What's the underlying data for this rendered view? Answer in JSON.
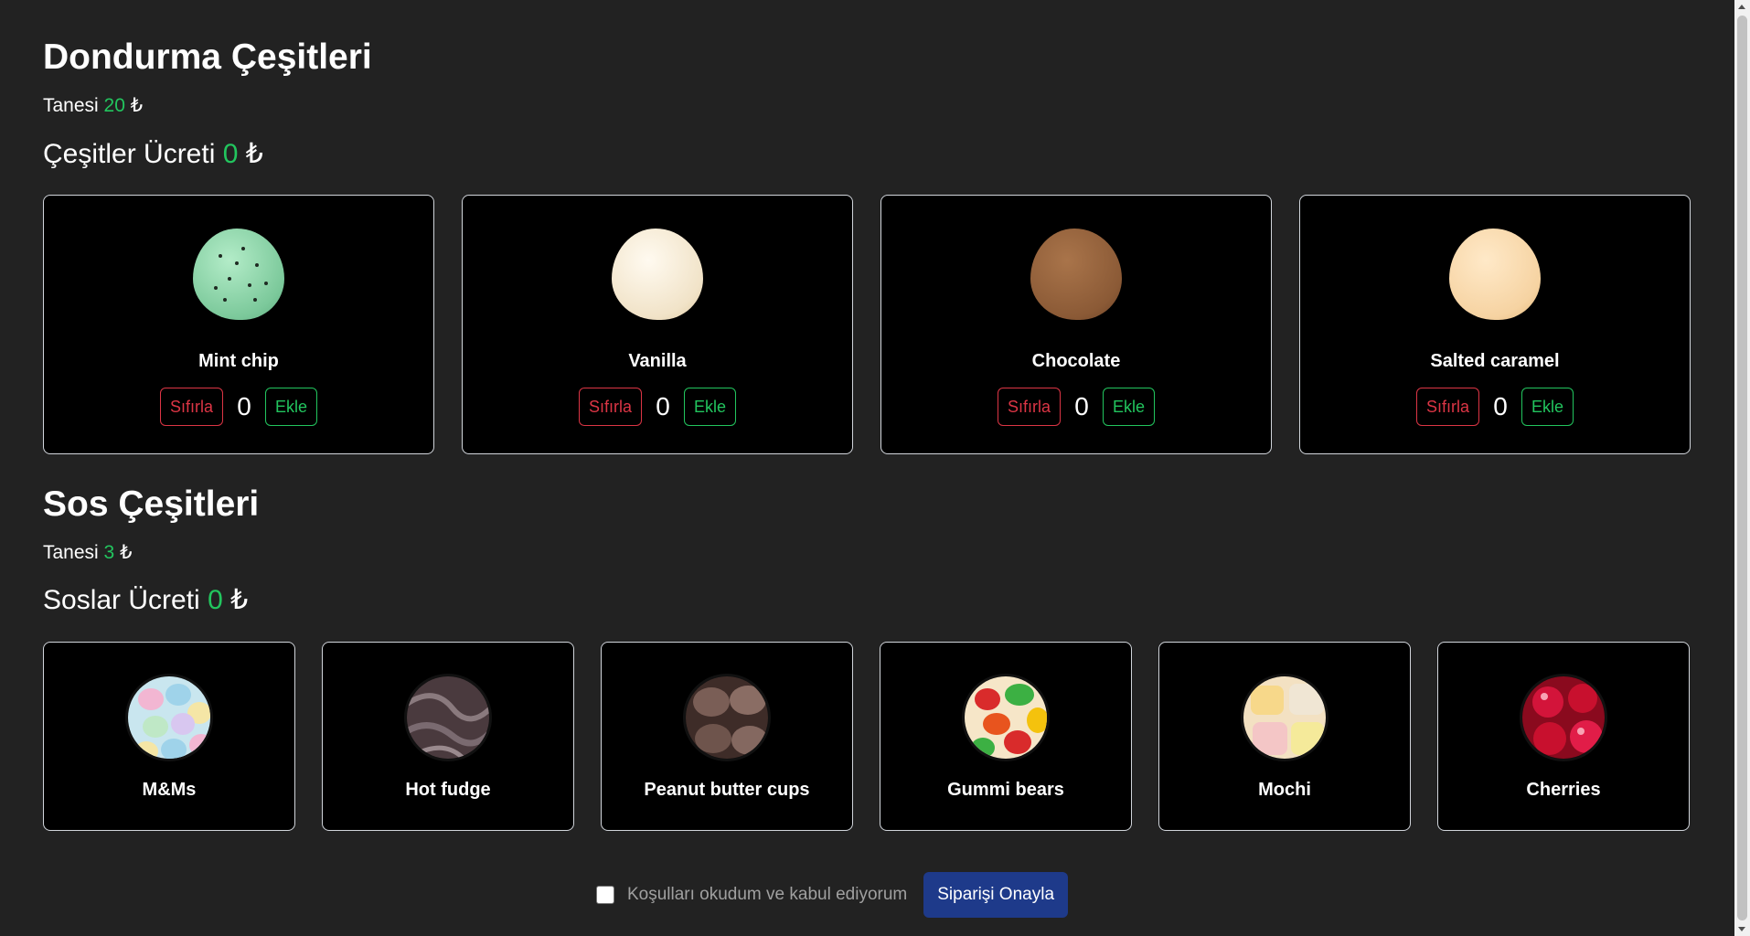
{
  "flavors_section": {
    "title": "Dondurma Çeşitleri",
    "unit_price_label": "Tanesi",
    "unit_price": "20",
    "currency": "₺",
    "fee_label": "Çeşitler Ücreti",
    "fee": "0",
    "items": [
      {
        "name": "Mint chip",
        "count": "0",
        "reset_label": "Sıfırla",
        "add_label": "Ekle",
        "icon": "mint-chip-scoop-icon",
        "color": "#8fd6ad"
      },
      {
        "name": "Vanilla",
        "count": "0",
        "reset_label": "Sıfırla",
        "add_label": "Ekle",
        "icon": "vanilla-scoop-icon",
        "color": "#f4ead7"
      },
      {
        "name": "Chocolate",
        "count": "0",
        "reset_label": "Sıfırla",
        "add_label": "Ekle",
        "icon": "chocolate-scoop-icon",
        "color": "#8b5a36"
      },
      {
        "name": "Salted caramel",
        "count": "0",
        "reset_label": "Sıfırla",
        "add_label": "Ekle",
        "icon": "salted-caramel-scoop-icon",
        "color": "#f6d3a2"
      }
    ]
  },
  "sauces_section": {
    "title": "Sos Çeşitleri",
    "unit_price_label": "Tanesi",
    "unit_price": "3",
    "currency": "₺",
    "fee_label": "Soslar Ücreti",
    "fee": "0",
    "items": [
      {
        "name": "M&Ms",
        "icon": "mms-topping-icon",
        "color": "#a7d8e8"
      },
      {
        "name": "Hot fudge",
        "icon": "hot-fudge-topping-icon",
        "color": "#5a4a4e"
      },
      {
        "name": "Peanut butter cups",
        "icon": "peanut-butter-cups-topping-icon",
        "color": "#6a5048"
      },
      {
        "name": "Gummi bears",
        "icon": "gummi-bears-topping-icon",
        "color": "#d93a3a"
      },
      {
        "name": "Mochi",
        "icon": "mochi-topping-icon",
        "color": "#f0d890"
      },
      {
        "name": "Cherries",
        "icon": "cherries-topping-icon",
        "color": "#c8102e"
      }
    ]
  },
  "footer": {
    "terms_label": "Koşulları okudum ve kabul ediyorum",
    "terms_checked": false,
    "confirm_label": "Siparişi Onayla"
  },
  "colors": {
    "background": "#222222",
    "card_background": "#000000",
    "accent_green": "#22c55e",
    "danger_red": "#dc3545",
    "primary_button": "#1e3a8a"
  }
}
